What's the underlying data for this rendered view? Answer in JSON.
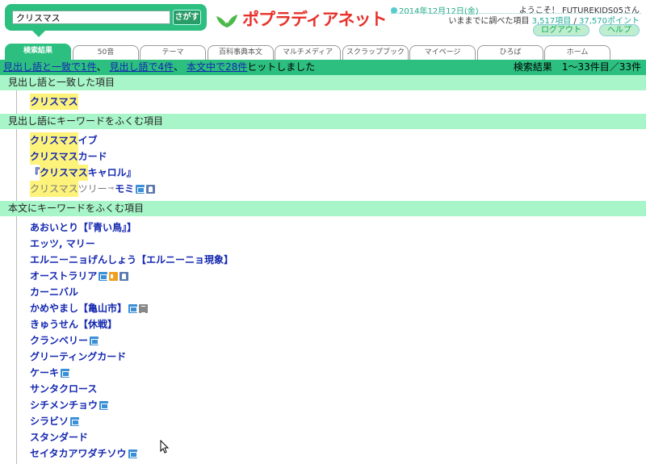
{
  "header": {
    "search_value": "クリスマス",
    "search_button": "さがす",
    "logo_text": "ポプラディアネット",
    "date": "2014年12月12日(金)",
    "welcome": "ようこそ！ FUTUREKIDS05さん",
    "stats_prefix": "いままでに調べた項目",
    "stats_items": "3,517項目",
    "stats_sep": "/",
    "stats_points": "37,570ポイント",
    "logout": "ログアウト",
    "help": "ヘルプ"
  },
  "tabs": [
    "検索結果",
    "50音",
    "テーマ",
    "百科事典本文",
    "マルチメディア",
    "スクラップブック",
    "マイページ",
    "ひろば",
    "ホーム"
  ],
  "result_bar": {
    "link1": "見出し語と一致で1件",
    "sep1": "、",
    "link2": "見出し語で4件",
    "sep2": "、",
    "link3": "本文中で28件",
    "suffix": "ヒットしました",
    "right": "検索結果　1〜33件目／33件"
  },
  "sections": {
    "exact": {
      "title": "見出し語と一致した項目",
      "items": [
        {
          "hl": "クリスマス",
          "tail": ""
        }
      ]
    },
    "contains": {
      "title": "見出し語にキーワードをふくむ項目",
      "items": [
        {
          "hl": "クリスマス",
          "tail": "イブ"
        },
        {
          "hl": "クリスマス",
          "tail": "カード"
        },
        {
          "pre": "『",
          "hl": "クリスマス",
          "tail": "キャロル』"
        },
        {
          "hl": "クリスマス",
          "tail": "ツリー",
          "mark": "⇒",
          "tail2": "モミ"
        }
      ]
    },
    "body": {
      "title": "本文にキーワードをふくむ項目",
      "items": [
        "あおいとり【『青い鳥』】",
        "エッツ, マリー",
        "エルニーニョげんしょう【エルニーニョ現象】",
        "オーストラリア",
        "カーニバル",
        "かめやまし【亀山市】",
        "きゅうせん【休戦】",
        "クランベリー",
        "グリーティングカード",
        "ケーキ",
        "サンタクロース",
        "シチメンチョウ",
        "シラビソ",
        "スタンダード",
        "セイタカアワダチソウ"
      ]
    }
  },
  "colors": {
    "accent": "#2cbf80",
    "section_bg": "#a7f5c8",
    "link": "#1428b0",
    "highlight": "#fdf27a"
  }
}
